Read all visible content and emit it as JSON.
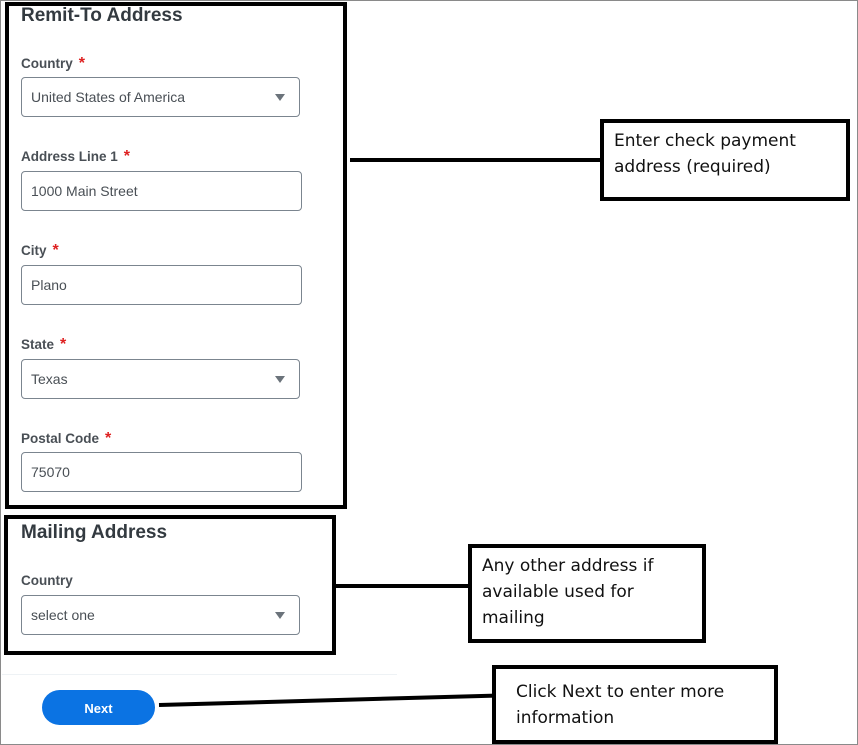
{
  "remit_to": {
    "title": "Remit-To Address",
    "fields": [
      {
        "label": "Country",
        "required": "*",
        "value": "United States of America",
        "type": "select"
      },
      {
        "label": "Address Line 1",
        "required": "*",
        "value": "1000 Main Street",
        "type": "text"
      },
      {
        "label": "City",
        "required": "*",
        "value": "Plano",
        "type": "text"
      },
      {
        "label": "State",
        "required": "*",
        "value": "Texas",
        "type": "select"
      },
      {
        "label": "Postal Code",
        "required": "*",
        "value": "75070",
        "type": "text"
      }
    ]
  },
  "mailing": {
    "title": "Mailing Address",
    "country_label": "Country",
    "country_value": "select one"
  },
  "actions": {
    "next_label": "Next"
  },
  "callouts": {
    "remit": "Enter check payment address (required)",
    "mailing": "Any other address if available used for mailing",
    "next": "Click Next to enter more information"
  },
  "colors": {
    "required": "#de2020",
    "primary_button": "#0b73e3"
  }
}
